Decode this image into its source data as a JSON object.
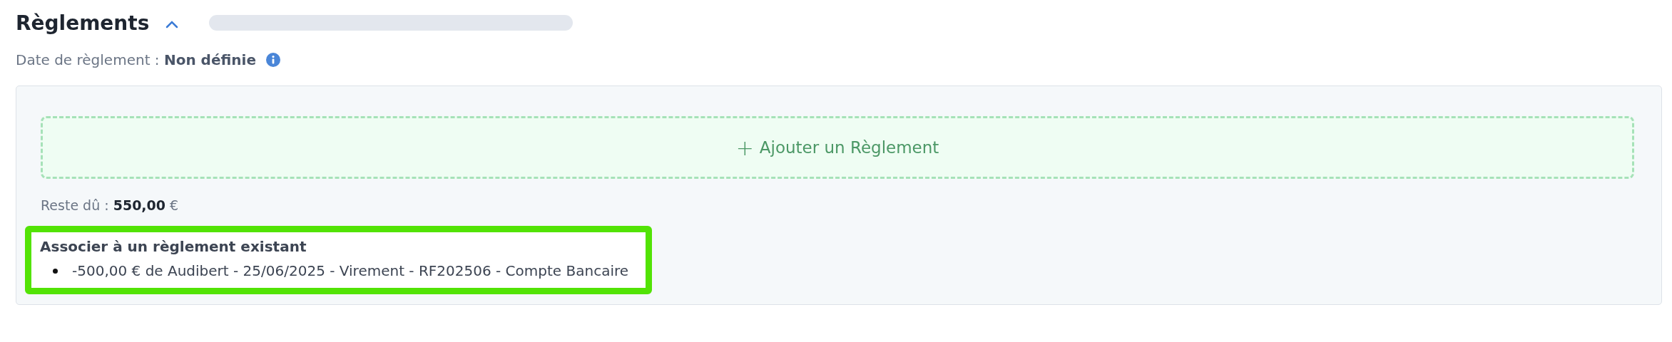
{
  "section": {
    "title": "Règlements",
    "expanded": true
  },
  "settlement_date": {
    "label": "Date de règlement : ",
    "value": "Non définie"
  },
  "add_button": {
    "icon": "+",
    "label": "Ajouter un Règlement"
  },
  "remaining": {
    "label": "Reste dû : ",
    "amount": "550,00",
    "currency": " €"
  },
  "existing": {
    "title": "Associer à un règlement existant",
    "highlighted": true,
    "items": [
      "-500,00 € de Audibert - 25/06/2025 - Virement - RF202506 - Compte Bancaire"
    ]
  }
}
